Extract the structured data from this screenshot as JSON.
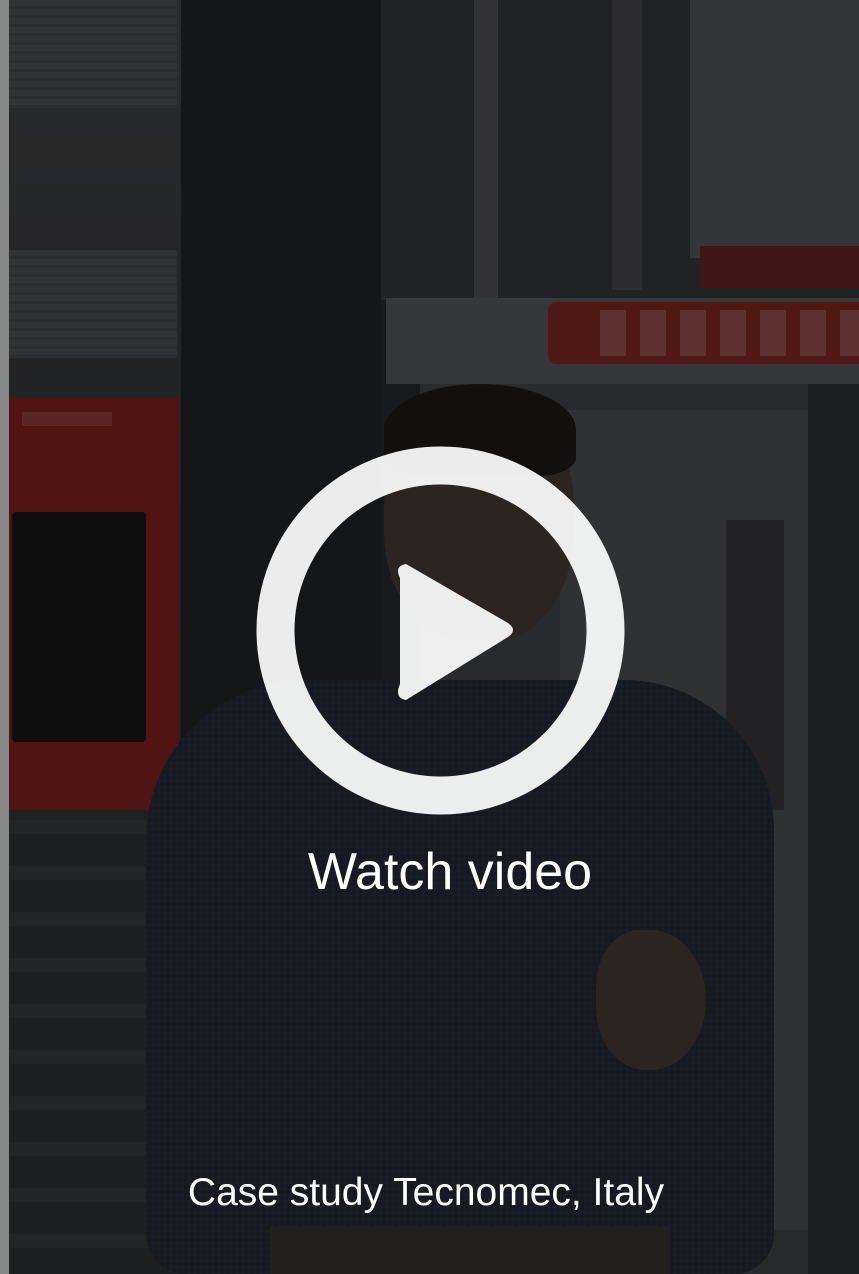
{
  "video": {
    "watch_label": "Watch video",
    "caption": "Case study Tecnomec, Italy",
    "play_icon": "play-circle-icon",
    "overlay_color": "#000000",
    "icon_color": "#ffffff"
  }
}
